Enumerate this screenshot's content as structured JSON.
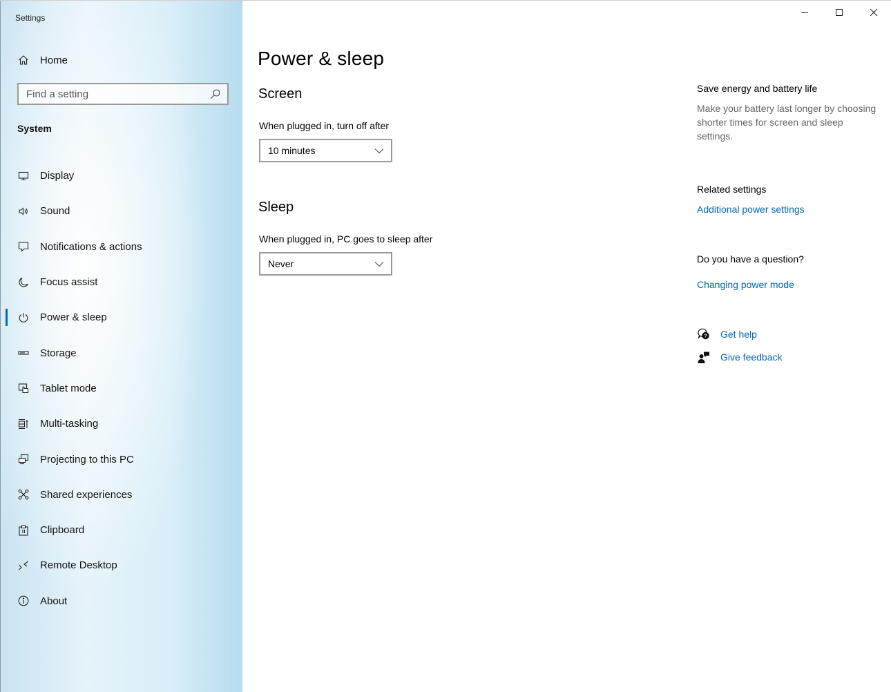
{
  "window": {
    "app_title": "Settings",
    "controls": [
      "minimize-icon",
      "maximize-icon",
      "close-icon"
    ]
  },
  "sidebar": {
    "home_label": "Home",
    "search": {
      "placeholder": "Find a setting",
      "value": ""
    },
    "section_label": "System",
    "items": [
      {
        "label": "Display",
        "icon": "display-icon",
        "active": false
      },
      {
        "label": "Sound",
        "icon": "speaker-icon",
        "active": false
      },
      {
        "label": "Notifications & actions",
        "icon": "notification-icon",
        "active": false
      },
      {
        "label": "Focus assist",
        "icon": "moon-icon",
        "active": false
      },
      {
        "label": "Power & sleep",
        "icon": "power-icon",
        "active": true
      },
      {
        "label": "Storage",
        "icon": "storage-icon",
        "active": false
      },
      {
        "label": "Tablet mode",
        "icon": "tablet-mode-icon",
        "active": false
      },
      {
        "label": "Multi-tasking",
        "icon": "multitasking-icon",
        "active": false
      },
      {
        "label": "Projecting to this PC",
        "icon": "projecting-icon",
        "active": false
      },
      {
        "label": "Shared experiences",
        "icon": "shared-experiences-icon",
        "active": false
      },
      {
        "label": "Clipboard",
        "icon": "clipboard-icon",
        "active": false
      },
      {
        "label": "Remote Desktop",
        "icon": "remote-desktop-icon",
        "active": false
      },
      {
        "label": "About",
        "icon": "info-icon",
        "active": false
      }
    ]
  },
  "main": {
    "title": "Power & sleep",
    "screen": {
      "heading": "Screen",
      "plugged_in_label": "When plugged in, turn off after",
      "plugged_in_value": "10 minutes"
    },
    "sleep": {
      "heading": "Sleep",
      "plugged_in_label": "When plugged in, PC goes to sleep after",
      "plugged_in_value": "Never"
    }
  },
  "aside": {
    "energy_heading": "Save energy and battery life",
    "energy_desc": "Make your battery last longer by choosing shorter times for screen and sleep settings.",
    "related_heading": "Related settings",
    "related_link": "Additional power settings",
    "question_heading": "Do you have a question?",
    "question_link": "Changing power mode",
    "get_help": "Get help",
    "give_feedback": "Give feedback"
  },
  "colors": {
    "accent": "#0067c0",
    "link": "#0067b8",
    "muted_text": "#666666"
  }
}
